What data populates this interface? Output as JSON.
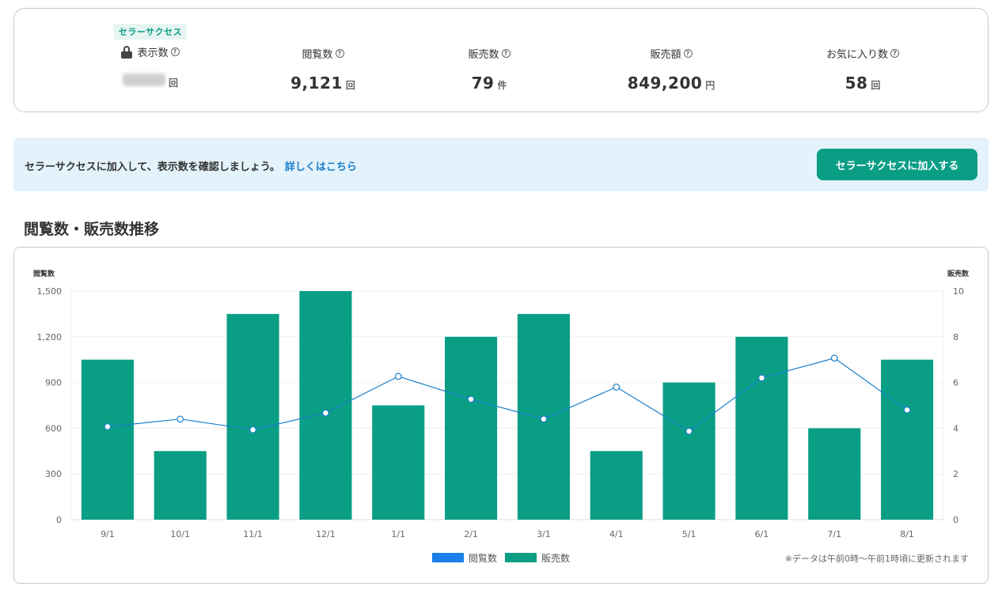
{
  "stats": {
    "badge": "セラーサクセス",
    "items": [
      {
        "label": "表示数",
        "value": "",
        "unit": "回",
        "locked": true
      },
      {
        "label": "閲覧数",
        "value": "9,121",
        "unit": "回"
      },
      {
        "label": "販売数",
        "value": "79",
        "unit": "件"
      },
      {
        "label": "販売額",
        "value": "849,200",
        "unit": "円"
      },
      {
        "label": "お気に入り数",
        "value": "58",
        "unit": "回"
      }
    ]
  },
  "banner": {
    "text": "セラーサクセスに加入して、表示数を確認しましょう。",
    "link": "詳しくはこちら",
    "button": "セラーサクセスに加入する"
  },
  "section_title": "閲覧数・販売数推移",
  "footnote": "※データは午前0時〜午前1時頃に更新されます",
  "colors": {
    "accent": "#0a9e85",
    "line": "#1a7fc9",
    "legend_line": "#1a7fe8",
    "banner_bg": "#e3f2fb"
  },
  "chart_data": {
    "type": "bar",
    "categories": [
      "9/1",
      "10/1",
      "11/1",
      "12/1",
      "1/1",
      "2/1",
      "3/1",
      "4/1",
      "5/1",
      "6/1",
      "7/1",
      "8/1"
    ],
    "series": [
      {
        "name": "閲覧数",
        "type": "line",
        "axis": "left",
        "values": [
          610,
          660,
          590,
          700,
          940,
          790,
          660,
          870,
          580,
          930,
          1060,
          720
        ]
      },
      {
        "name": "販売数",
        "type": "bar",
        "axis": "right",
        "values": [
          7,
          3,
          9,
          10,
          5,
          8,
          9,
          3,
          6,
          8,
          4,
          7
        ]
      }
    ],
    "left_axis": {
      "title": "閲覧数",
      "ticks": [
        "0",
        "300",
        "600",
        "900",
        "1,200",
        "1,500"
      ],
      "ylim": [
        0,
        1500
      ]
    },
    "right_axis": {
      "title": "販売数",
      "ticks": [
        "0",
        "2",
        "4",
        "6",
        "8",
        "10"
      ],
      "ylim": [
        0,
        10
      ]
    },
    "legend_position": "bottom-center",
    "grid": true
  }
}
